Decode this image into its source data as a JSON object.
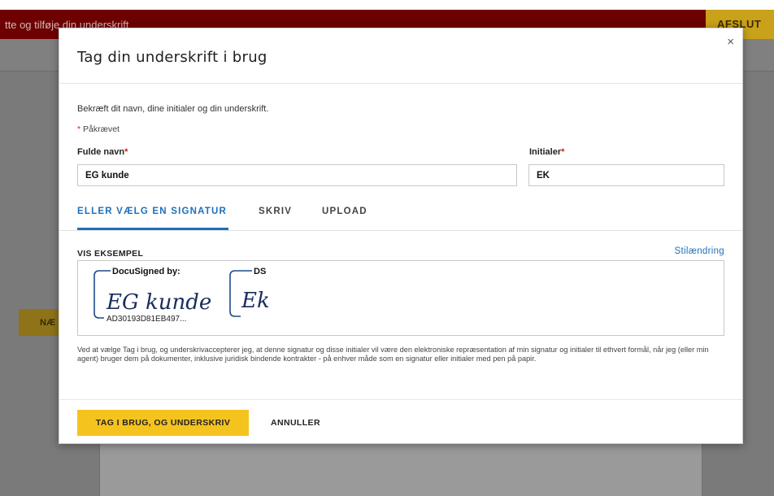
{
  "background": {
    "banner_text": "tte og tilføje din underskrift",
    "finish_button": "AFSLUT",
    "next_button": "NÆ"
  },
  "modal": {
    "title": "Tag din underskrift i brug",
    "intro": "Bekræft dit navn, dine initialer og din underskrift.",
    "required_note": "Påkrævet",
    "full_name": {
      "label": "Fulde navn",
      "value": "EG kunde"
    },
    "initials": {
      "label": "Initialer",
      "value": "EK"
    },
    "tabs": [
      {
        "label": "ELLER VÆLG EN SIGNATUR",
        "active": true
      },
      {
        "label": "SKRIV",
        "active": false
      },
      {
        "label": "UPLOAD",
        "active": false
      }
    ],
    "preview": {
      "label": "VIS EKSEMPEL",
      "style_link": "Stilændring",
      "signature_header": "DocuSigned by:",
      "signature_text": "EG kunde",
      "signature_id": "AD30193D81EB497...",
      "initials_header": "DS",
      "initials_text": "Ek"
    },
    "legal_text": "Ved at vælge Tag i brug, og underskrivaccepterer jeg, at denne signatur og disse initialer vil være den elektroniske repræsentation af min signatur og initialer til ethvert formål, når jeg (eller min agent) bruger dem på dokumenter, inklusive juridisk bindende kontrakter - på enhver måde som en signatur eller initialer med pen på papir.",
    "adopt_button": "TAG I BRUG, OG UNDERSKRIV",
    "cancel_button": "ANNULLER",
    "close_symbol": "×"
  },
  "colors": {
    "accent_blue": "#1f6fba",
    "primary_yellow": "#f5c31e",
    "banner_red": "#6d0000",
    "signature_ink": "#1a2d5c"
  },
  "icons": {
    "close": "close-icon"
  }
}
